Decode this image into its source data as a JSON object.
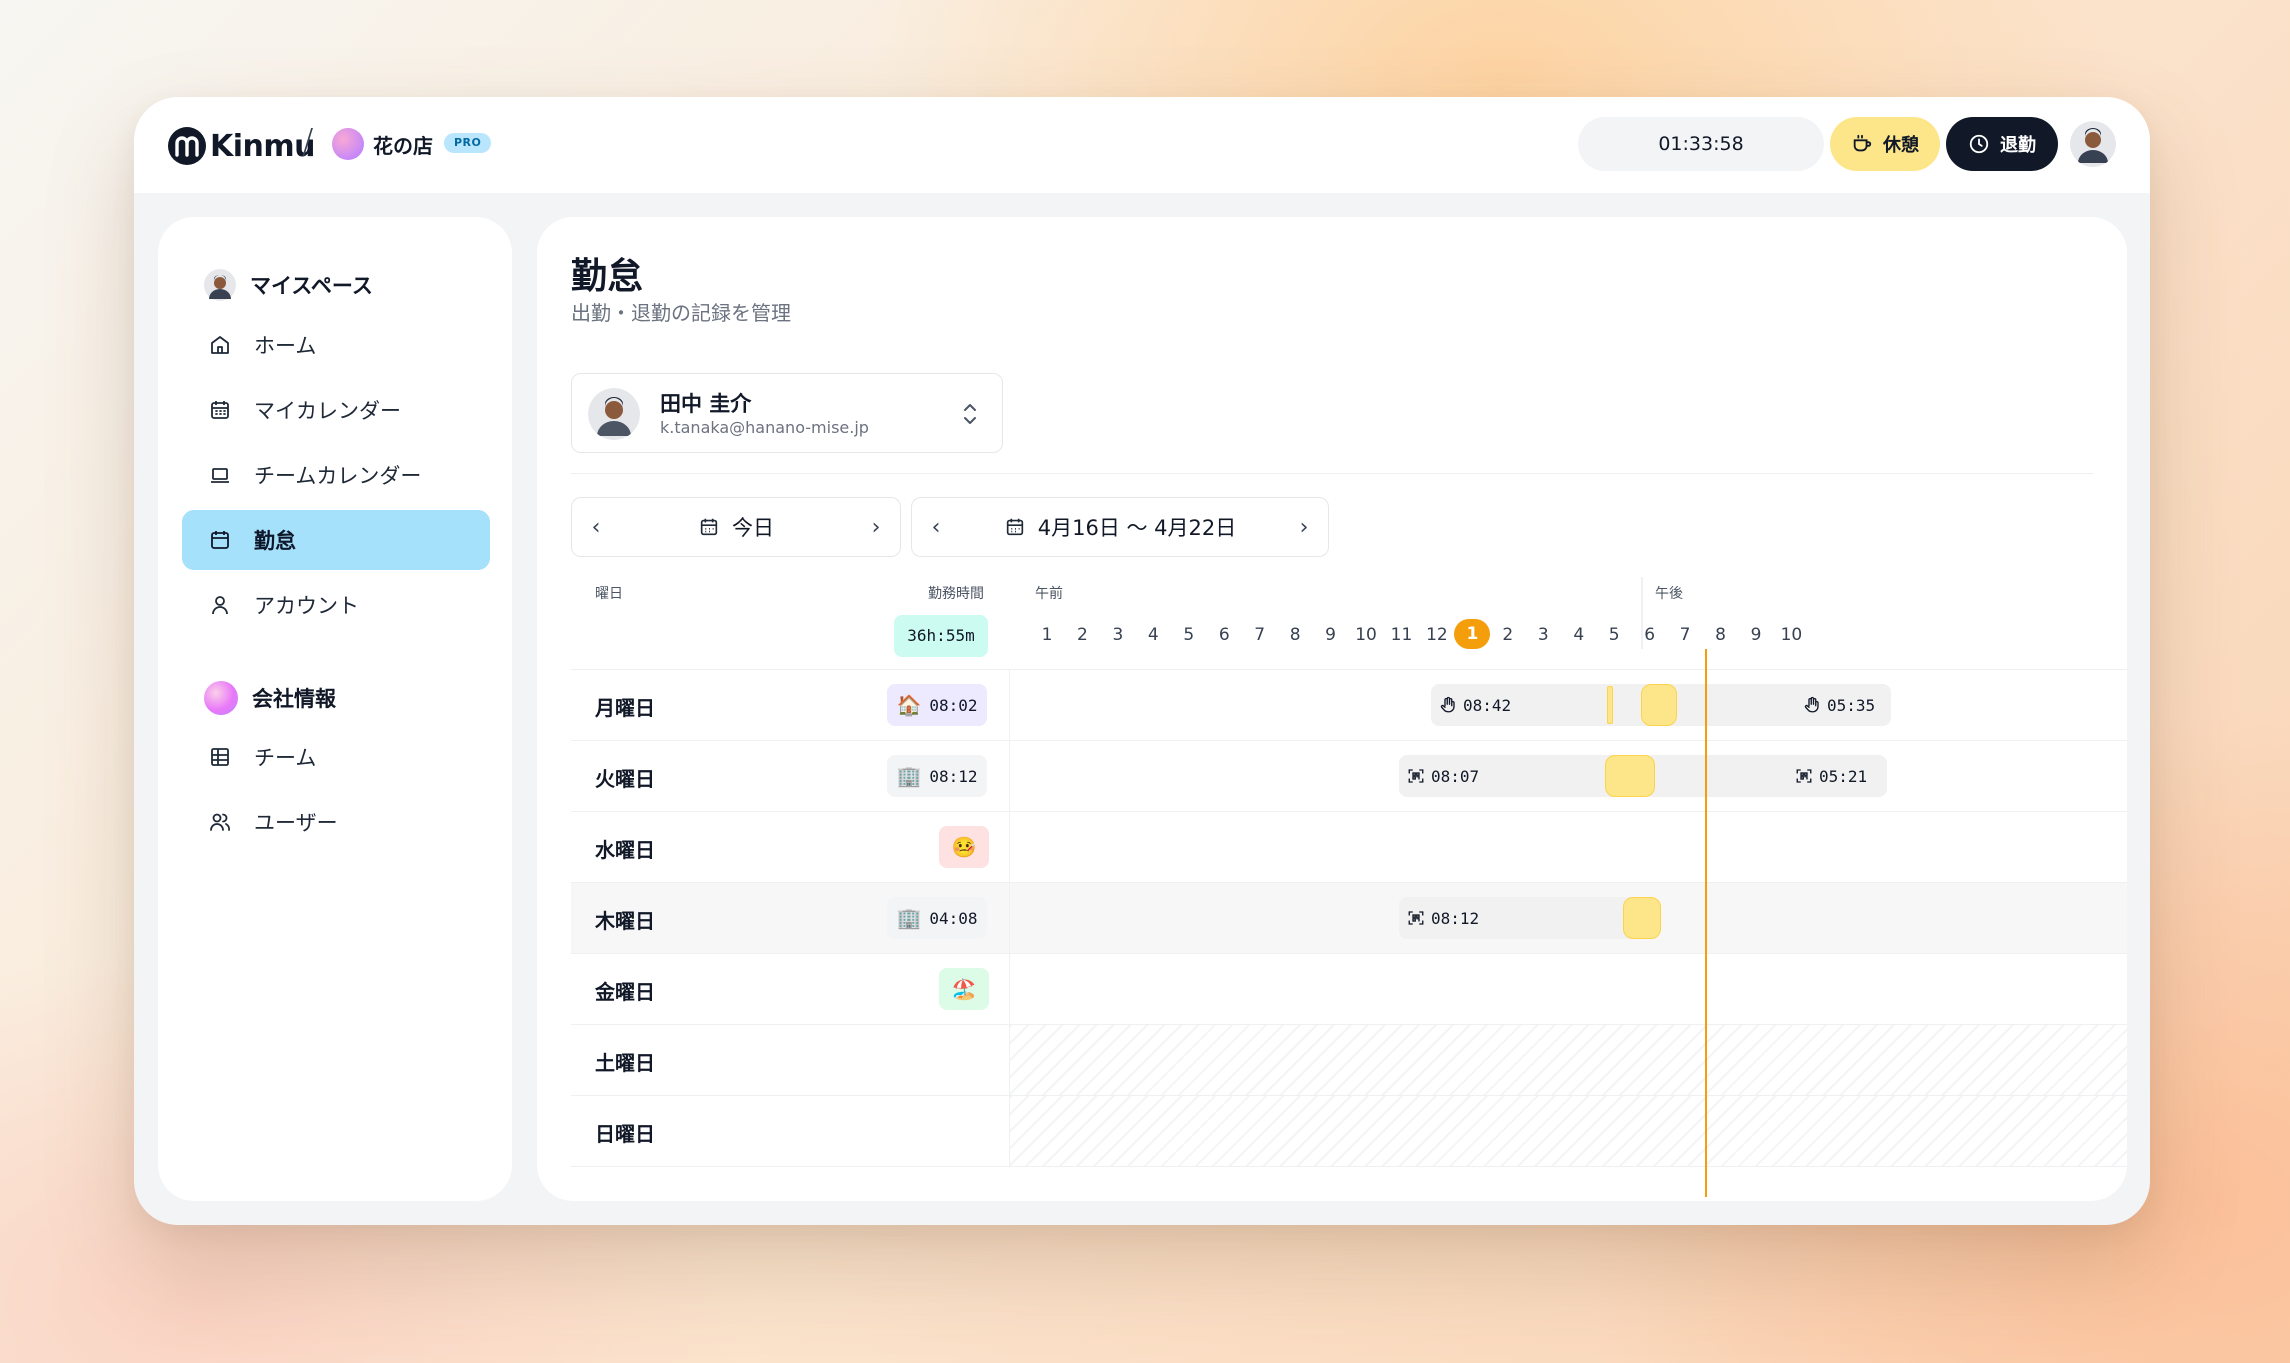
{
  "brand": {
    "name": "Kinmu",
    "org_name": "花の店",
    "plan_badge": "PRO"
  },
  "topbar": {
    "timer": "01:33:58",
    "break_label": "休憩",
    "clockout_label": "退勤"
  },
  "sidebar": {
    "section_personal": "マイスペース",
    "personal_items": [
      {
        "label": "ホーム",
        "icon": "home-icon"
      },
      {
        "label": "マイカレンダー",
        "icon": "calendar-icon"
      },
      {
        "label": "チームカレンダー",
        "icon": "laptop-icon"
      },
      {
        "label": "勤怠",
        "icon": "calendar-check-icon",
        "active": true
      },
      {
        "label": "アカウント",
        "icon": "user-icon"
      }
    ],
    "section_company": "会社情報",
    "company_items": [
      {
        "label": "チーム",
        "icon": "table-icon"
      },
      {
        "label": "ユーザー",
        "icon": "users-icon"
      }
    ]
  },
  "page": {
    "title": "勤怠",
    "subtitle": "出勤・退勤の記録を管理"
  },
  "user_select": {
    "name": "田中 圭介",
    "email": "k.tanaka@hanano-mise.jp"
  },
  "date_nav": {
    "today_label": "今日",
    "range_label": "4月16日 〜 4月22日"
  },
  "table": {
    "col_day": "曜日",
    "col_hours": "勤務時間",
    "total_hours": "36h:55m",
    "am_label": "午前",
    "pm_label": "午後",
    "hours": [
      "1",
      "2",
      "3",
      "4",
      "5",
      "6",
      "7",
      "8",
      "9",
      "10",
      "11",
      "12",
      "1",
      "2",
      "3",
      "4",
      "5",
      "6",
      "7",
      "8",
      "9",
      "10"
    ],
    "current_hour_index": 12,
    "rows": [
      {
        "day": "月曜日",
        "emoji": "🏠",
        "duration": "08:02",
        "pill_color": "#ede9fe",
        "in": "08:42",
        "out": "05:35",
        "in_icon": "hand-icon",
        "out_icon": "hand-icon"
      },
      {
        "day": "火曜日",
        "emoji": "🏢",
        "duration": "08:12",
        "pill_color": "#f3f4f6",
        "in": "08:07",
        "out": "05:21",
        "in_icon": "qr-scan-icon",
        "out_icon": "qr-scan-icon"
      },
      {
        "day": "水曜日",
        "emoji": "🤒",
        "duration": "",
        "pill_color": "#fee2e2"
      },
      {
        "day": "木曜日",
        "emoji": "🏢",
        "duration": "04:08",
        "pill_color": "#f3f4f6",
        "in": "08:12",
        "in_icon": "qr-scan-icon"
      },
      {
        "day": "金曜日",
        "emoji": "🏖️",
        "duration": "",
        "pill_color": "#dcfce7"
      },
      {
        "day": "土曜日"
      },
      {
        "day": "日曜日"
      }
    ]
  },
  "colors": {
    "accent": "#a5e1fb",
    "now": "#f59e0b",
    "break": "#fde68a",
    "dark": "#111827"
  }
}
